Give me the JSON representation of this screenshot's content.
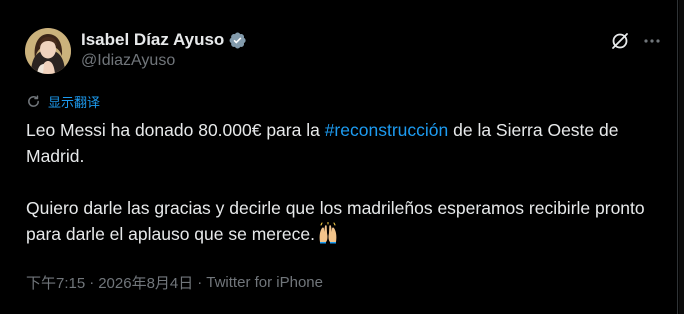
{
  "author": {
    "display_name": "Isabel Díaz Ayuso",
    "handle": "@IdiazAyuso",
    "verified": true
  },
  "actions": {
    "grok_icon": "grok-icon",
    "more_icon": "more-icon"
  },
  "translate": {
    "label": "显示翻译",
    "icon": "translate-icon"
  },
  "tweet": {
    "line1_before": "Leo Messi ha donado 80.000€ para la ",
    "hashtag": "#reconstrucción",
    "line1_after": " de la Sierra Oeste de Madrid.",
    "paragraph2": "Quiero darle las gracias y decirle que los madrileños esperamos recibirle pronto para darle el aplauso que se merece.",
    "emoji": "raising-hands-emoji"
  },
  "meta": {
    "time": "下午7:15",
    "separator1": "·",
    "date": "2026年8月4日",
    "separator2": "·",
    "source": "Twitter for iPhone"
  },
  "colors": {
    "background": "#000000",
    "text": "#e7e9ea",
    "secondary": "#71767b",
    "accent": "#1d9bf0"
  }
}
